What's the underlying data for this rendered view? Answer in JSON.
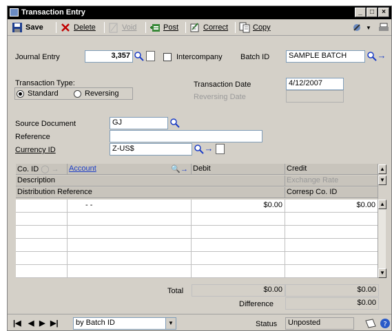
{
  "window": {
    "title": "Transaction Entry"
  },
  "toolbar": {
    "save": "Save",
    "delete": "Delete",
    "void": "Void",
    "post": "Post",
    "correct": "Correct",
    "copy": "Copy"
  },
  "header": {
    "journal_entry_label": "Journal Entry",
    "journal_entry_value": "3,357",
    "intercompany_label": "Intercompany",
    "batch_id_label": "Batch ID",
    "batch_id_value": "SAMPLE BATCH",
    "transaction_type_label": "Transaction Type:",
    "type_standard": "Standard",
    "type_reversing": "Reversing",
    "transaction_date_label": "Transaction Date",
    "transaction_date_value": "4/12/2007",
    "reversing_date_label": "Reversing Date",
    "source_document_label": "Source Document",
    "source_document_value": "GJ",
    "reference_label": "Reference",
    "reference_value": "",
    "currency_id_label": "Currency ID",
    "currency_id_value": "Z-US$"
  },
  "grid": {
    "col_co_id": "Co. ID",
    "col_account": "Account",
    "col_debit": "Debit",
    "col_credit": "Credit",
    "col_description": "Description",
    "col_exchange_rate": "Exchange Rate",
    "col_distribution_reference": "Distribution Reference",
    "col_corresp_co_id": "Corresp Co. ID",
    "rows": [
      {
        "account": "-      -",
        "debit": "$0.00",
        "credit": "$0.00"
      },
      {
        "account": "",
        "debit": "",
        "credit": ""
      },
      {
        "account": "",
        "debit": "",
        "credit": ""
      },
      {
        "account": "",
        "debit": "",
        "credit": ""
      },
      {
        "account": "",
        "debit": "",
        "credit": ""
      },
      {
        "account": "",
        "debit": "",
        "credit": ""
      }
    ]
  },
  "totals": {
    "total_label": "Total",
    "total_debit": "$0.00",
    "total_credit": "$0.00",
    "difference_label": "Difference",
    "difference_value": "$0.00"
  },
  "statusbar": {
    "sort_value": "by Batch ID",
    "status_label": "Status",
    "status_value": "Unposted"
  },
  "colors": {
    "title_bar": "#000000",
    "window_bg": "#d4d0c8",
    "link": "#1a3cc6"
  }
}
